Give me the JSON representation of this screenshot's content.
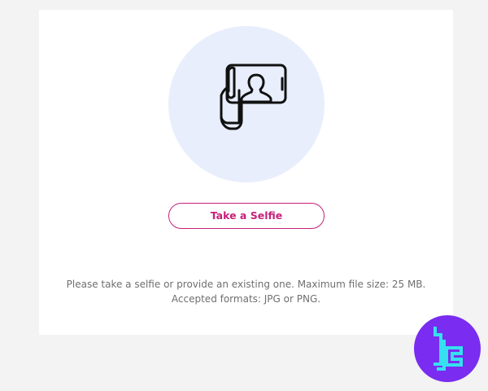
{
  "selfie": {
    "button_label": "Take a Selfie",
    "instructions_line1": "Please take a selfie or provide an existing one. Maximum file size: 25 MB.",
    "instructions_line2": "Accepted formats: JPG or PNG.",
    "illustration_icon": "hand-holding-phone-selfie-icon"
  },
  "branding": {
    "logo_icon": "brand-logo-icon"
  },
  "colors": {
    "page_background": "#f3f3f3",
    "card_background": "#ffffff",
    "illustration_circle": "#e8eefc",
    "accent": "#c7207a",
    "text_muted": "#6f6f6f",
    "logo_background": "#7a2cf0",
    "logo_mark": "#35e0f0"
  }
}
